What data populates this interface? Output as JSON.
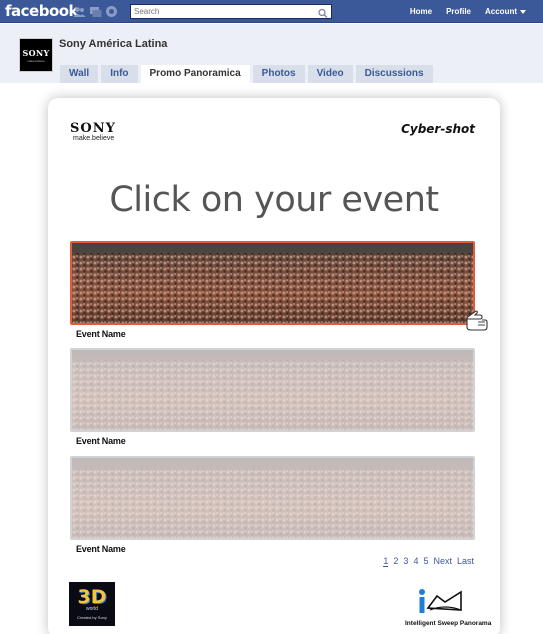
{
  "facebook": {
    "logo": "facebook",
    "search_placeholder": "Search",
    "nav": {
      "home": "Home",
      "profile": "Profile",
      "account": "Account"
    },
    "jewel_icons": [
      "friend-requests-icon",
      "messages-icon",
      "notifications-icon"
    ],
    "bar_color": "#3b5998"
  },
  "page": {
    "name": "Sony América Latina",
    "profile_pic": {
      "brand": "SONY",
      "sub": "make.believe"
    },
    "tabs": [
      {
        "label": "Wall",
        "active": false
      },
      {
        "label": "Info",
        "active": false
      },
      {
        "label": "Promo Panoramica",
        "active": true
      },
      {
        "label": "Photos",
        "active": false
      },
      {
        "label": "Video",
        "active": false
      },
      {
        "label": "Discussions",
        "active": false
      }
    ]
  },
  "promo": {
    "sony": "SONY",
    "tagline": "make.believe",
    "cybershot": "Cyber-shot",
    "headline": "Click on your event",
    "events": [
      {
        "label": "Event Name",
        "selected": true
      },
      {
        "label": "Event Name",
        "selected": false
      },
      {
        "label": "Event Name",
        "selected": false
      }
    ],
    "pagination": [
      "1",
      "2",
      "3",
      "4",
      "5",
      "Next",
      "Last"
    ],
    "current_page": "1",
    "badge_3d": {
      "big": "3D",
      "world": "world",
      "created": "Created by Sony"
    },
    "isp_label": "Intelligent Sweep Panorama",
    "selected_border_color": "#e35a3c"
  }
}
